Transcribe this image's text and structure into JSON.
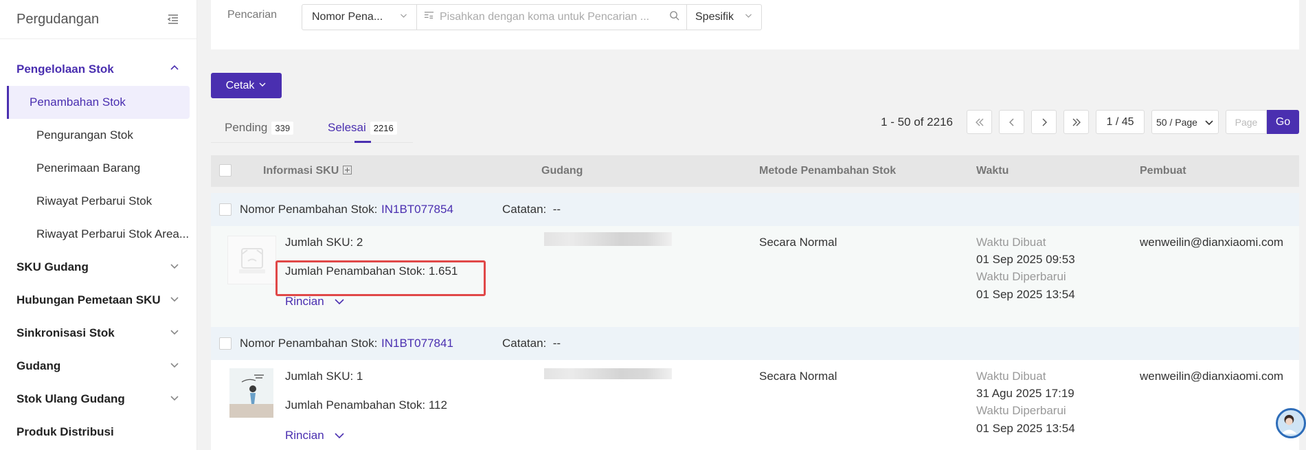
{
  "sidebar": {
    "title": "Pergudangan",
    "groups": [
      {
        "label": "Pengelolaan Stok"
      },
      {
        "label": "SKU Gudang"
      },
      {
        "label": "Hubungan Pemetaan SKU"
      },
      {
        "label": "Sinkronisasi Stok"
      },
      {
        "label": "Gudang"
      },
      {
        "label": "Stok Ulang Gudang"
      },
      {
        "label": "Produk Distribusi"
      }
    ],
    "subitems": [
      {
        "label": "Penambahan Stok"
      },
      {
        "label": "Pengurangan Stok"
      },
      {
        "label": "Penerimaan Barang"
      },
      {
        "label": "Riwayat Perbarui Stok"
      },
      {
        "label": "Riwayat Perbarui Stok Area..."
      }
    ]
  },
  "search": {
    "label": "Pencarian",
    "field_select": "Nomor Pena...",
    "placeholder": "Pisahkan dengan koma untuk Pencarian ...",
    "mode": "Spesifik"
  },
  "toolbar": {
    "print_label": "Cetak"
  },
  "tabs": [
    {
      "label": "Pending",
      "count": "339"
    },
    {
      "label": "Selesai",
      "count": "2216"
    }
  ],
  "pager": {
    "range": "1 - 50 of 2216",
    "current": "1 / 45",
    "page_size": "50 / Page",
    "jump_placeholder": "Page",
    "go_label": "Go"
  },
  "table": {
    "columns": [
      "Informasi SKU",
      "Gudang",
      "Metode Penambahan Stok",
      "Waktu",
      "Pembuat"
    ],
    "records": [
      {
        "number_label": "Nomor Penambahan Stok:",
        "number": "IN1BT077854",
        "note_label": "Catatan:",
        "note": "--",
        "sku_count": "Jumlah SKU: 2",
        "qty": "Jumlah Penambahan Stok: 1.651",
        "detail": "Rincian",
        "method": "Secara Normal",
        "created_label": "Waktu Dibuat",
        "created": "01 Sep 2025 09:53",
        "updated_label": "Waktu Diperbarui",
        "updated": "01 Sep 2025 13:54",
        "creator": "wenweilin@dianxiaomi.com"
      },
      {
        "number_label": "Nomor Penambahan Stok:",
        "number": "IN1BT077841",
        "note_label": "Catatan:",
        "note": "--",
        "sku_count": "Jumlah SKU: 1",
        "qty": "Jumlah Penambahan Stok: 112",
        "detail": "Rincian",
        "method": "Secara Normal",
        "created_label": "Waktu Dibuat",
        "created": "31 Agu 2025 17:19",
        "updated_label": "Waktu Diperbarui",
        "updated": "01 Sep 2025 13:54",
        "creator": "wenweilin@dianxiaomi.com"
      }
    ]
  },
  "colors": {
    "accent": "#4a2fb0",
    "highlight": "#e04848"
  }
}
